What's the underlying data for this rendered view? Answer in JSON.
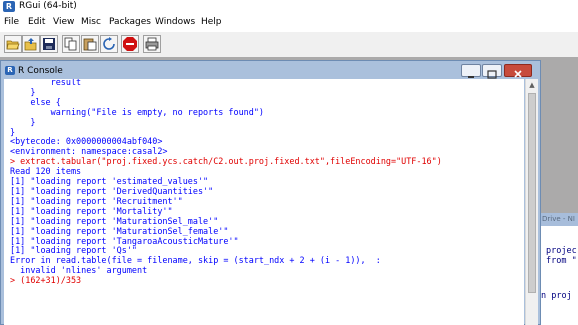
{
  "app": {
    "title": "RGui (64-bit)",
    "icon_text": "R"
  },
  "menu": [
    "File",
    "Edit",
    "View",
    "Misc",
    "Packages",
    "Windows",
    "Help"
  ],
  "toolbar": {
    "buttons": [
      "open-script",
      "load-workspace",
      "save-workspace",
      "copy",
      "paste",
      "copy-and-paste",
      "stop",
      "print"
    ]
  },
  "console": {
    "title": "R Console",
    "icon_text": "R",
    "lines": [
      {
        "text": "        result",
        "color": "#0000ff"
      },
      {
        "text": "    }",
        "color": "#0000ff"
      },
      {
        "text": "    else {",
        "color": "#0000ff"
      },
      {
        "text": "        warning(\"File is empty, no reports found\")",
        "color": "#0000ff"
      },
      {
        "text": "    }",
        "color": "#0000ff"
      },
      {
        "text": "}",
        "color": "#0000ff"
      },
      {
        "text": "<bytecode: 0x0000000004abf040>",
        "color": "#0000ff"
      },
      {
        "text": "<environment: namespace:casal2>",
        "color": "#0000ff"
      },
      {
        "text": "> extract.tabular(\"proj.fixed.ycs.catch/C2.out.proj.fixed.txt\",fileEncoding=\"UTF-16\")",
        "color": "#e00000"
      },
      {
        "text": "Read 120 items",
        "color": "#0000ff"
      },
      {
        "text": "[1] \"loading report 'estimated_values'\"",
        "color": "#0000ff"
      },
      {
        "text": "[1] \"loading report 'DerivedQuantities'\"",
        "color": "#0000ff"
      },
      {
        "text": "[1] \"loading report 'Recruitment'\"",
        "color": "#0000ff"
      },
      {
        "text": "[1] \"loading report 'Mortality'\"",
        "color": "#0000ff"
      },
      {
        "text": "[1] \"loading report 'MaturationSel_male'\"",
        "color": "#0000ff"
      },
      {
        "text": "[1] \"loading report 'MaturationSel_female'\"",
        "color": "#0000ff"
      },
      {
        "text": "[1] \"loading report 'TangaroaAcousticMature'\"",
        "color": "#0000ff"
      },
      {
        "text": "[1] \"loading report 'Qs'\"",
        "color": "#0000ff"
      },
      {
        "text": "Error in read.table(file = filename, skip = (start_ndx + 2 + (i - 1)),  :",
        "color": "#0000ff"
      },
      {
        "text": "  invalid 'nlines' argument",
        "color": "#0000ff"
      },
      {
        "text": "> (162+31)/353",
        "color": "#e00000"
      }
    ]
  },
  "background_window": {
    "title": "Drive - NI",
    "lines": [
      "projec",
      "from \"",
      "n proj"
    ]
  }
}
